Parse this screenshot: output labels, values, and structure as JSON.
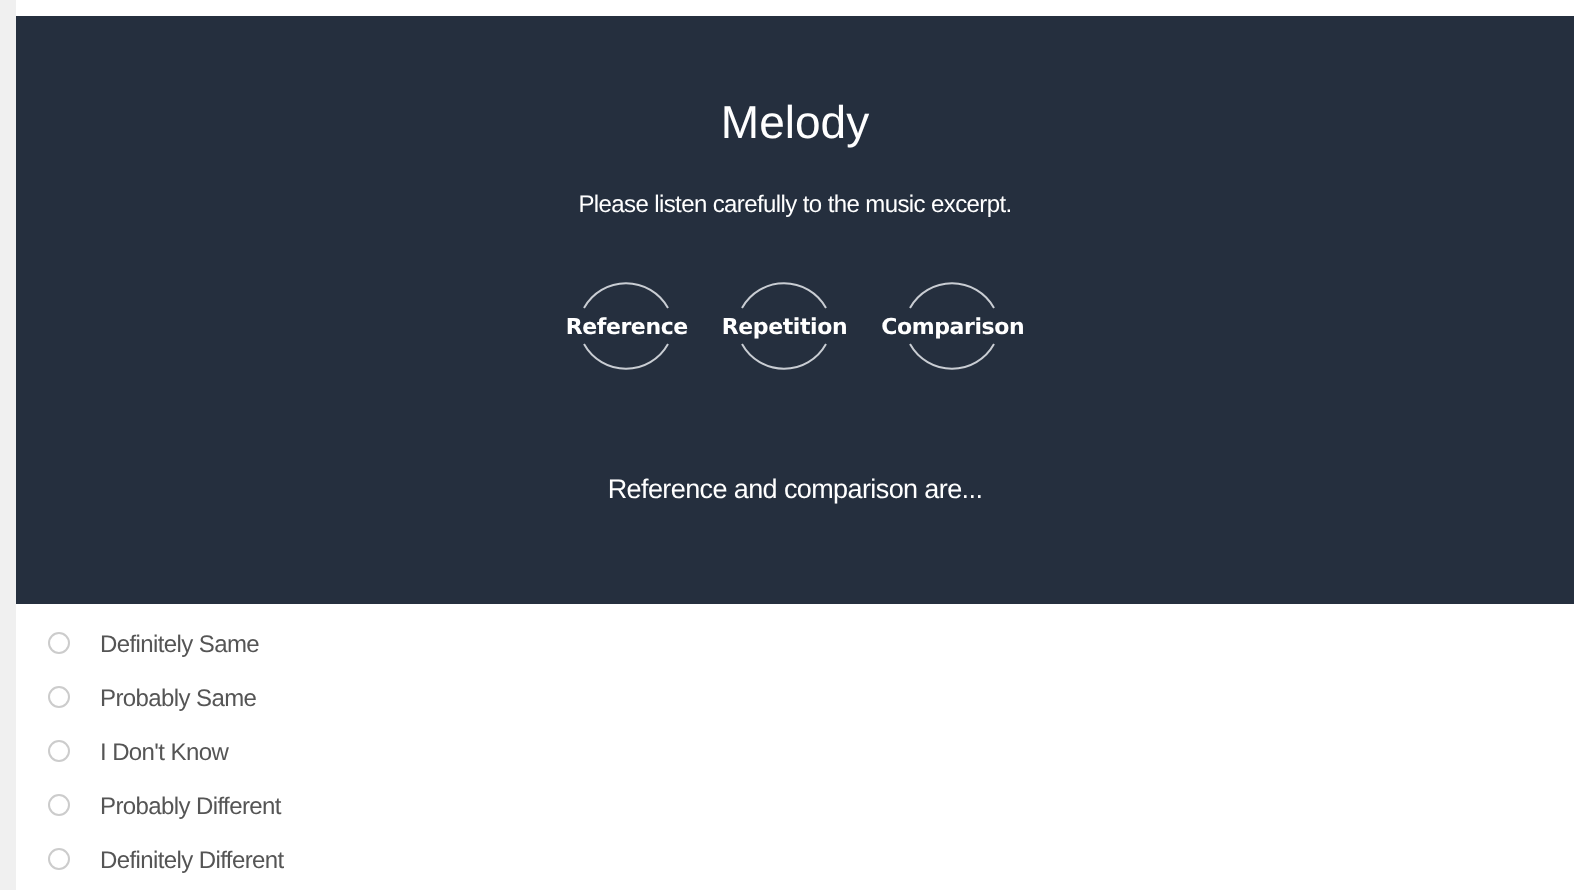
{
  "header": {
    "title": "Melody",
    "instruction": "Please listen carefully to the music excerpt.",
    "sounds": [
      {
        "label": "Reference"
      },
      {
        "label": "Repetition"
      },
      {
        "label": "Comparison"
      }
    ],
    "question": "Reference and comparison are..."
  },
  "options": [
    {
      "label": "Definitely Same",
      "selected": false
    },
    {
      "label": "Probably Same",
      "selected": false
    },
    {
      "label": "I Don't Know",
      "selected": false
    },
    {
      "label": "Probably Different",
      "selected": false
    },
    {
      "label": "Definitely Different",
      "selected": false
    }
  ]
}
